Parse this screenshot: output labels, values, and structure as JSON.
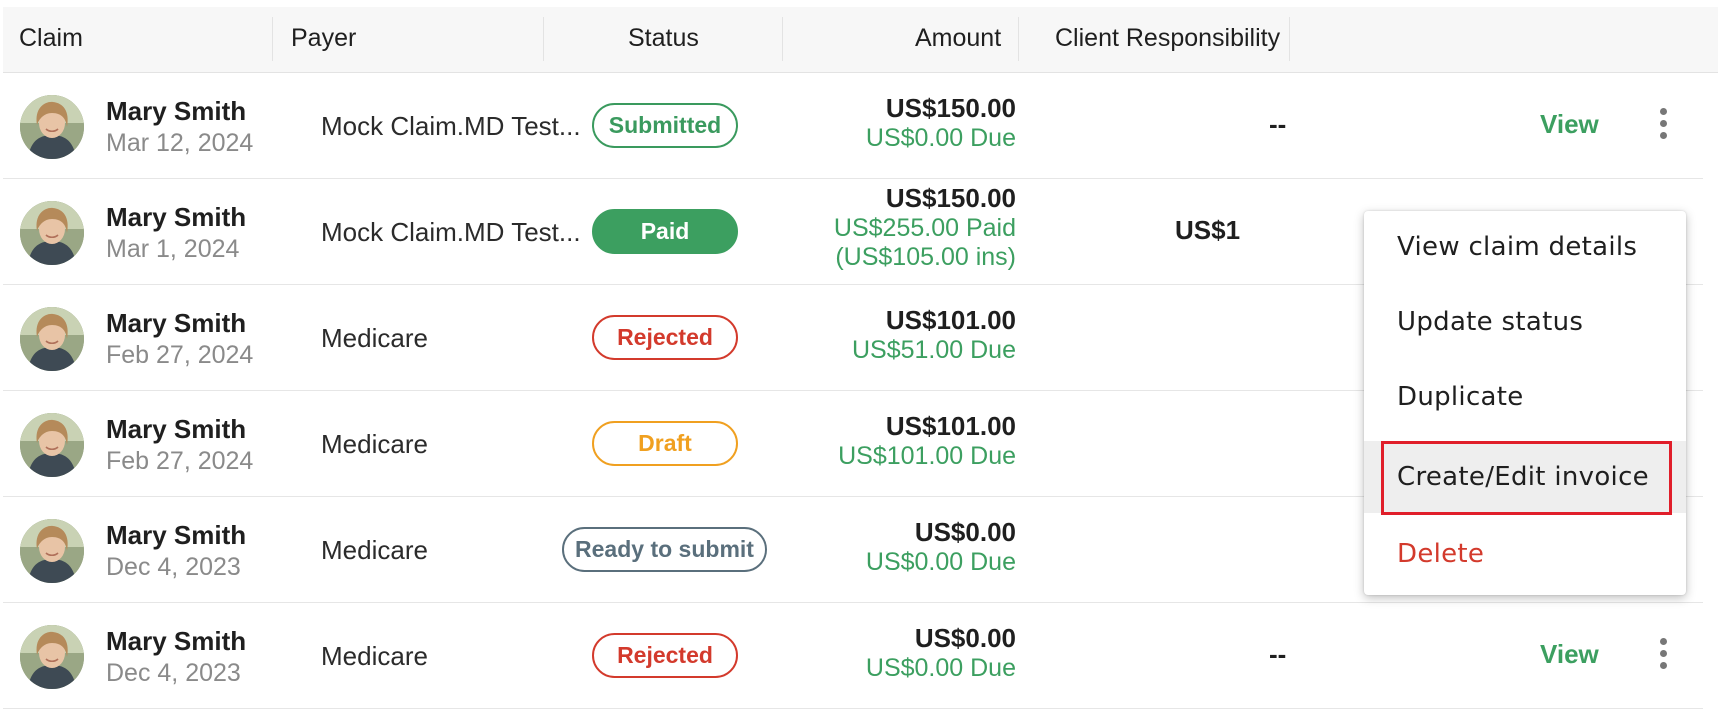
{
  "table": {
    "headers": {
      "claim": "Claim",
      "payer": "Payer",
      "status": "Status",
      "amount": "Amount",
      "client_responsibility": "Client Responsibility"
    },
    "rows": [
      {
        "name": "Mary Smith",
        "date": "Mar 12, 2024",
        "payer": "Mock Claim.MD Test...",
        "status": "Submitted",
        "amount": "US$150.00",
        "due": "US$0.00 Due",
        "due2": "",
        "responsibility": "--",
        "view": "View"
      },
      {
        "name": "Mary Smith",
        "date": "Mar 1, 2024",
        "payer": "Mock Claim.MD Test...",
        "status": "Paid",
        "amount": "US$150.00",
        "due": "US$255.00 Paid",
        "due2": "(US$105.00 ins)",
        "responsibility": "US$1",
        "view": ""
      },
      {
        "name": "Mary Smith",
        "date": "Feb 27, 2024",
        "payer": "Medicare",
        "status": "Rejected",
        "amount": "US$101.00",
        "due": "US$51.00 Due",
        "due2": "",
        "responsibility": "",
        "view": ""
      },
      {
        "name": "Mary Smith",
        "date": "Feb 27, 2024",
        "payer": "Medicare",
        "status": "Draft",
        "amount": "US$101.00",
        "due": "US$101.00 Due",
        "due2": "",
        "responsibility": "",
        "view": ""
      },
      {
        "name": "Mary Smith",
        "date": "Dec 4, 2023",
        "payer": "Medicare",
        "status": "Ready to submit",
        "amount": "US$0.00",
        "due": "US$0.00 Due",
        "due2": "",
        "responsibility": "",
        "view": ""
      },
      {
        "name": "Mary Smith",
        "date": "Dec 4, 2023",
        "payer": "Medicare",
        "status": "Rejected",
        "amount": "US$0.00",
        "due": "US$0.00 Due",
        "due2": "",
        "responsibility": "--",
        "view": "View"
      }
    ]
  },
  "context_menu": {
    "items": [
      "View claim details",
      "Update status",
      "Duplicate",
      "Create/Edit invoice",
      "Delete"
    ],
    "highlighted": "Create/Edit invoice"
  },
  "colors": {
    "accent_green": "#3c9f60",
    "danger_red": "#d33a2c",
    "draft_orange": "#f0a020",
    "ready_slate": "#5a6f7c",
    "highlight_box": "#e01e2a"
  },
  "icons": {
    "avatar": "user-photo-avatar",
    "row_menu": "vertical-ellipsis-icon"
  }
}
